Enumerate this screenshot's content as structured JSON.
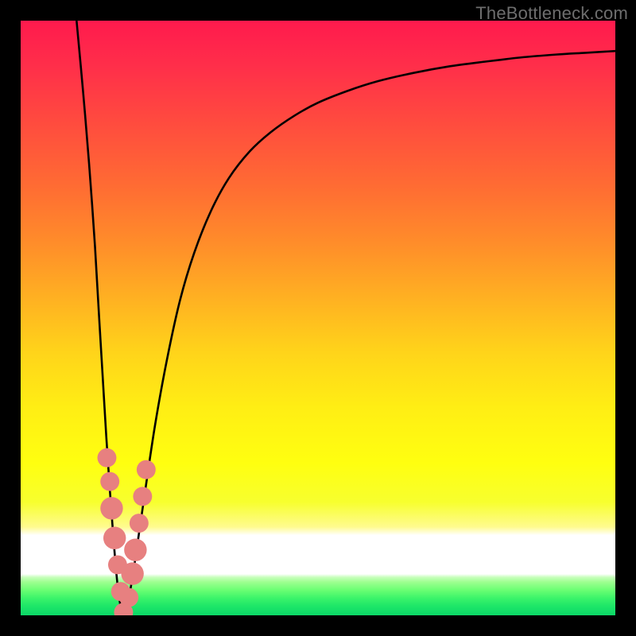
{
  "attribution": "TheBottleneck.com",
  "colors": {
    "frame_bg": "#000000",
    "curve": "#000000",
    "marker_fill": "#e78080",
    "gradient_top": "#ff1a4d",
    "gradient_bottom": "#0cd767"
  },
  "chart_data": {
    "type": "line",
    "title": "",
    "xlabel": "",
    "ylabel": "",
    "xlim": [
      0,
      100
    ],
    "ylim": [
      0,
      100
    ],
    "grid": false,
    "background": "heatmap-gradient",
    "series": [
      {
        "name": "left-descent",
        "x": [
          9.4,
          10.5,
          11.5,
          12.5,
          13.2,
          13.8,
          14.4,
          15.0,
          15.6,
          16.2,
          16.8,
          17.3
        ],
        "y": [
          100,
          88.0,
          76.0,
          62.0,
          50.0,
          40.0,
          30.0,
          21.0,
          13.0,
          6.0,
          1.5,
          0.0
        ]
      },
      {
        "name": "main-curve",
        "x": [
          17.3,
          18.2,
          19.2,
          20.8,
          22.6,
          24.6,
          26.8,
          29.2,
          32.0,
          35.0,
          38.5,
          42.0,
          46.0,
          50.0,
          55.0,
          60.0,
          66.0,
          72.0,
          78.0,
          84.0,
          90.0,
          95.0,
          100.0
        ],
        "y": [
          0.0,
          3.0,
          9.0,
          20.0,
          32.0,
          43.0,
          53.0,
          61.0,
          68.0,
          73.5,
          78.0,
          81.2,
          84.0,
          86.2,
          88.2,
          89.8,
          91.2,
          92.3,
          93.1,
          93.8,
          94.3,
          94.6,
          94.9
        ]
      }
    ],
    "markers": [
      {
        "name": "left-cluster",
        "points": [
          {
            "x": 14.5,
            "y": 26.5,
            "r": 1.6
          },
          {
            "x": 15.0,
            "y": 22.5,
            "r": 1.6
          },
          {
            "x": 15.3,
            "y": 18.0,
            "r": 1.9
          },
          {
            "x": 15.8,
            "y": 13.0,
            "r": 1.9
          },
          {
            "x": 16.3,
            "y": 8.5,
            "r": 1.6
          },
          {
            "x": 16.8,
            "y": 4.0,
            "r": 1.6
          },
          {
            "x": 17.3,
            "y": 0.5,
            "r": 1.6
          }
        ]
      },
      {
        "name": "right-cluster",
        "points": [
          {
            "x": 18.2,
            "y": 3.0,
            "r": 1.6
          },
          {
            "x": 18.8,
            "y": 7.0,
            "r": 1.9
          },
          {
            "x": 19.3,
            "y": 11.0,
            "r": 1.9
          },
          {
            "x": 19.9,
            "y": 15.5,
            "r": 1.6
          },
          {
            "x": 20.5,
            "y": 20.0,
            "r": 1.6
          },
          {
            "x": 21.1,
            "y": 24.5,
            "r": 1.6
          }
        ]
      }
    ]
  }
}
